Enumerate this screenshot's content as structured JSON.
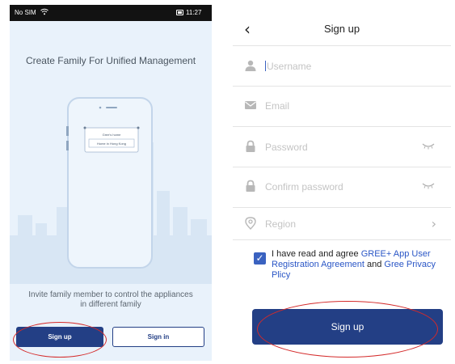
{
  "left_screen": {
    "status_bar": {
      "carrier": "No SIM",
      "wifi_icon": "wifi-icon",
      "battery_icon": "battery-icon",
      "time": "11:27"
    },
    "headline": "Create Family For Unified Management",
    "illustration": {
      "card_line1": "Gree's home",
      "card_line2": "Home in Hong Kong"
    },
    "invite_text": "Invite family member to control the appliances in different family",
    "buttons": {
      "signup": "Sign up",
      "signin": "Sign in"
    }
  },
  "right_screen": {
    "nav": {
      "back_icon": "chevron-left-icon",
      "title": "Sign up"
    },
    "fields": {
      "username": {
        "placeholder": "Username",
        "icon": "user-icon"
      },
      "email": {
        "placeholder": "Email",
        "icon": "envelope-icon"
      },
      "password": {
        "placeholder": "Password",
        "icon": "lock-icon",
        "toggle_icon": "eye-closed-icon"
      },
      "confirm": {
        "placeholder": "Confirm password",
        "icon": "lock-icon",
        "toggle_icon": "eye-closed-icon"
      },
      "region": {
        "placeholder": "Region",
        "icon": "location-pin-icon",
        "chevron_icon": "chevron-right-icon"
      }
    },
    "agreement": {
      "checked": true,
      "prefix": "I have read and agree ",
      "link1": "GREE+ App User Registration Agreement",
      "middle": " and ",
      "link2": "Gree Privacy Plicy"
    },
    "submit": "Sign up"
  },
  "colors": {
    "brand_blue": "#233f85",
    "link_blue": "#2a56c6",
    "annotation_red": "#d42a2a",
    "left_bg": "#e9f2fb"
  }
}
